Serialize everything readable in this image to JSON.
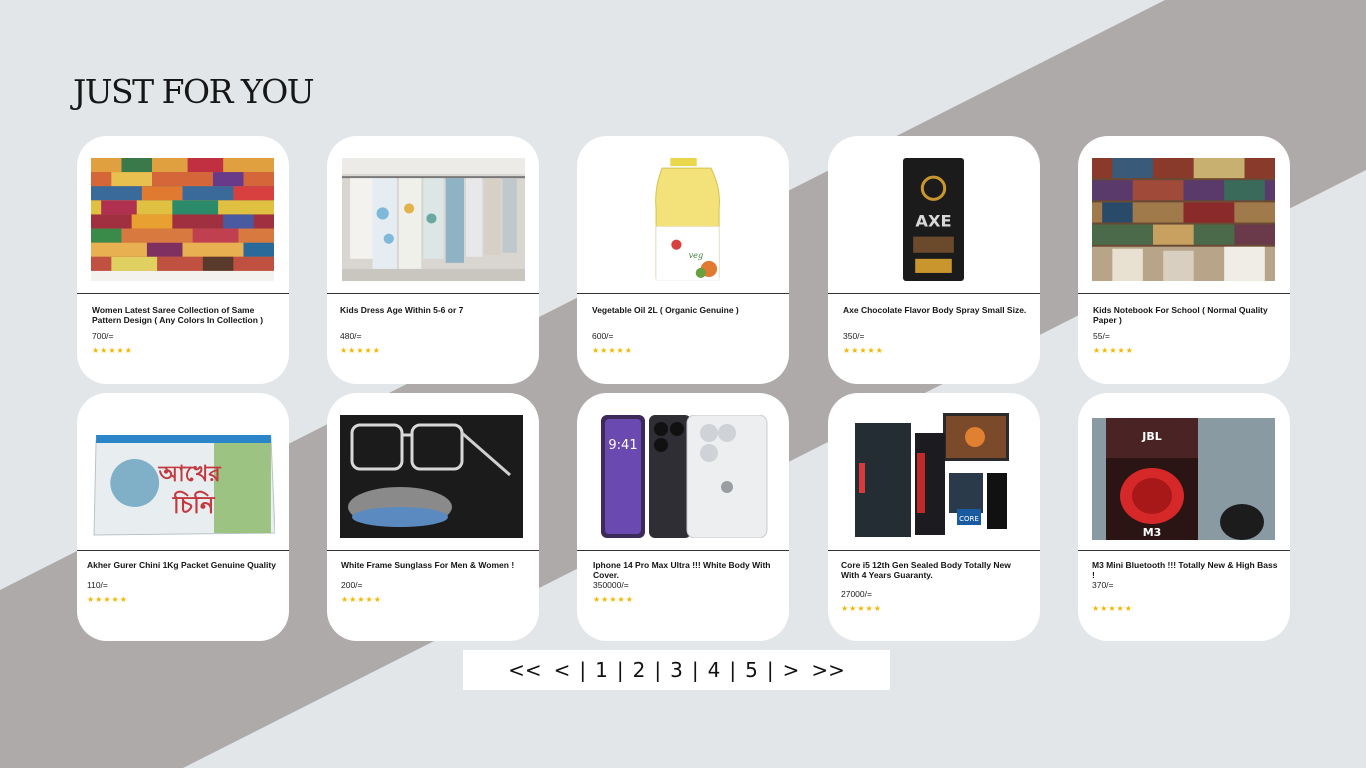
{
  "page": {
    "title": "JUST FOR YOU"
  },
  "colors": {
    "background": "#e3e6e9",
    "band": "#aeaaa9",
    "card": "#ffffff",
    "star": "#f2b705"
  },
  "products": [
    {
      "name": "Women Latest Saree Collection of Same Pattern Design ( Any Colors In Collection )",
      "price": "700/=",
      "rating": "★★★★★",
      "image": "saree-stack-image"
    },
    {
      "name": "Kids Dress Age Within 5-6 or 7",
      "price": "480/=",
      "rating": "★★★★★",
      "image": "kids-dress-rack-image"
    },
    {
      "name": "Vegetable Oil 2L ( Organic Genuine )",
      "price": "600/=",
      "rating": "★★★★★",
      "image": "oil-bottle-image"
    },
    {
      "name": "Axe Chocolate Flavor Body Spray Small Size.",
      "price": "350/=",
      "rating": "★★★★★",
      "image": "axe-spray-image"
    },
    {
      "name": "Kids Notebook For School ( Normal Quality Paper )",
      "price": "55/=",
      "rating": "★★★★★",
      "image": "book-stacks-image"
    },
    {
      "name": "Akher Gurer Chini 1Kg Packet Genuine Quality",
      "price": "110/=",
      "rating": "★★★★★",
      "image": "sugar-packet-image"
    },
    {
      "name": "White Frame Sunglass For Men & Women !",
      "price": "200/=",
      "rating": "★★★★★",
      "image": "clear-glasses-image"
    },
    {
      "name": "Iphone 14 Pro Max Ultra !!! White Body With Cover.",
      "price": "350000/=",
      "rating": "★★★★★",
      "image": "iphone-image"
    },
    {
      "name": "Core i5 12th Gen Sealed Body Totally New With 4 Years Guaranty.",
      "price": "27000/=",
      "rating": "★★★★★",
      "image": "desktop-pc-image"
    },
    {
      "name": "M3 Mini Bluetooth !!! Totally New & High Bass !",
      "price": "370/=",
      "rating": "★★★★★",
      "image": "jbl-speaker-image"
    }
  ],
  "image_text": {
    "packet_line1": "আখের",
    "packet_line2": "চিনি",
    "phone_time": "9:41",
    "pc_badge": "CORE",
    "jbl_logo": "JBL",
    "jbl_model": "M3"
  },
  "pagination": {
    "first": "<<",
    "prev": "<",
    "sep": "|",
    "pages": [
      "1",
      "2",
      "3",
      "4",
      "5"
    ],
    "next": ">",
    "last": ">>"
  }
}
